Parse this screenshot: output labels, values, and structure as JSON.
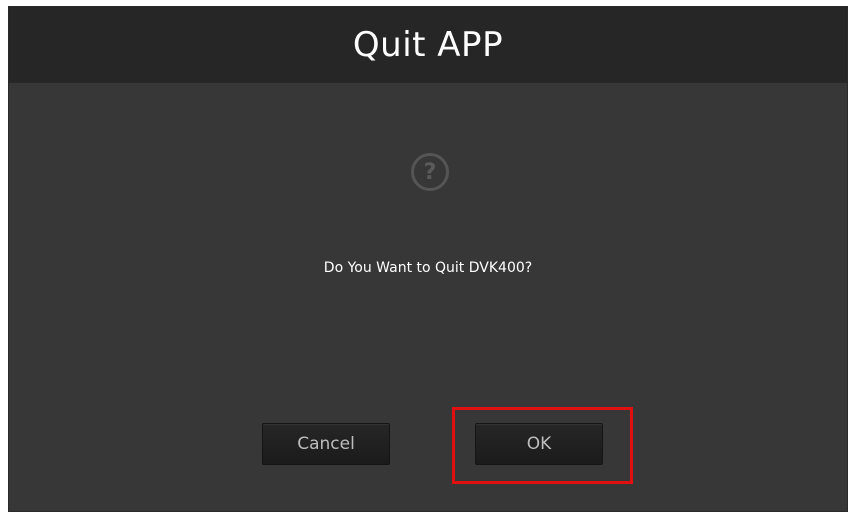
{
  "dialog": {
    "title": "Quit APP",
    "icon": "question-icon",
    "icon_glyph": "?",
    "message": "Do You Want to Quit DVK400?",
    "buttons": {
      "cancel_label": "Cancel",
      "ok_label": "OK"
    }
  },
  "colors": {
    "title_bar_bg": "#262626",
    "body_bg": "#373737",
    "button_bg": "#1f1f1f",
    "highlight": "#e01010"
  }
}
